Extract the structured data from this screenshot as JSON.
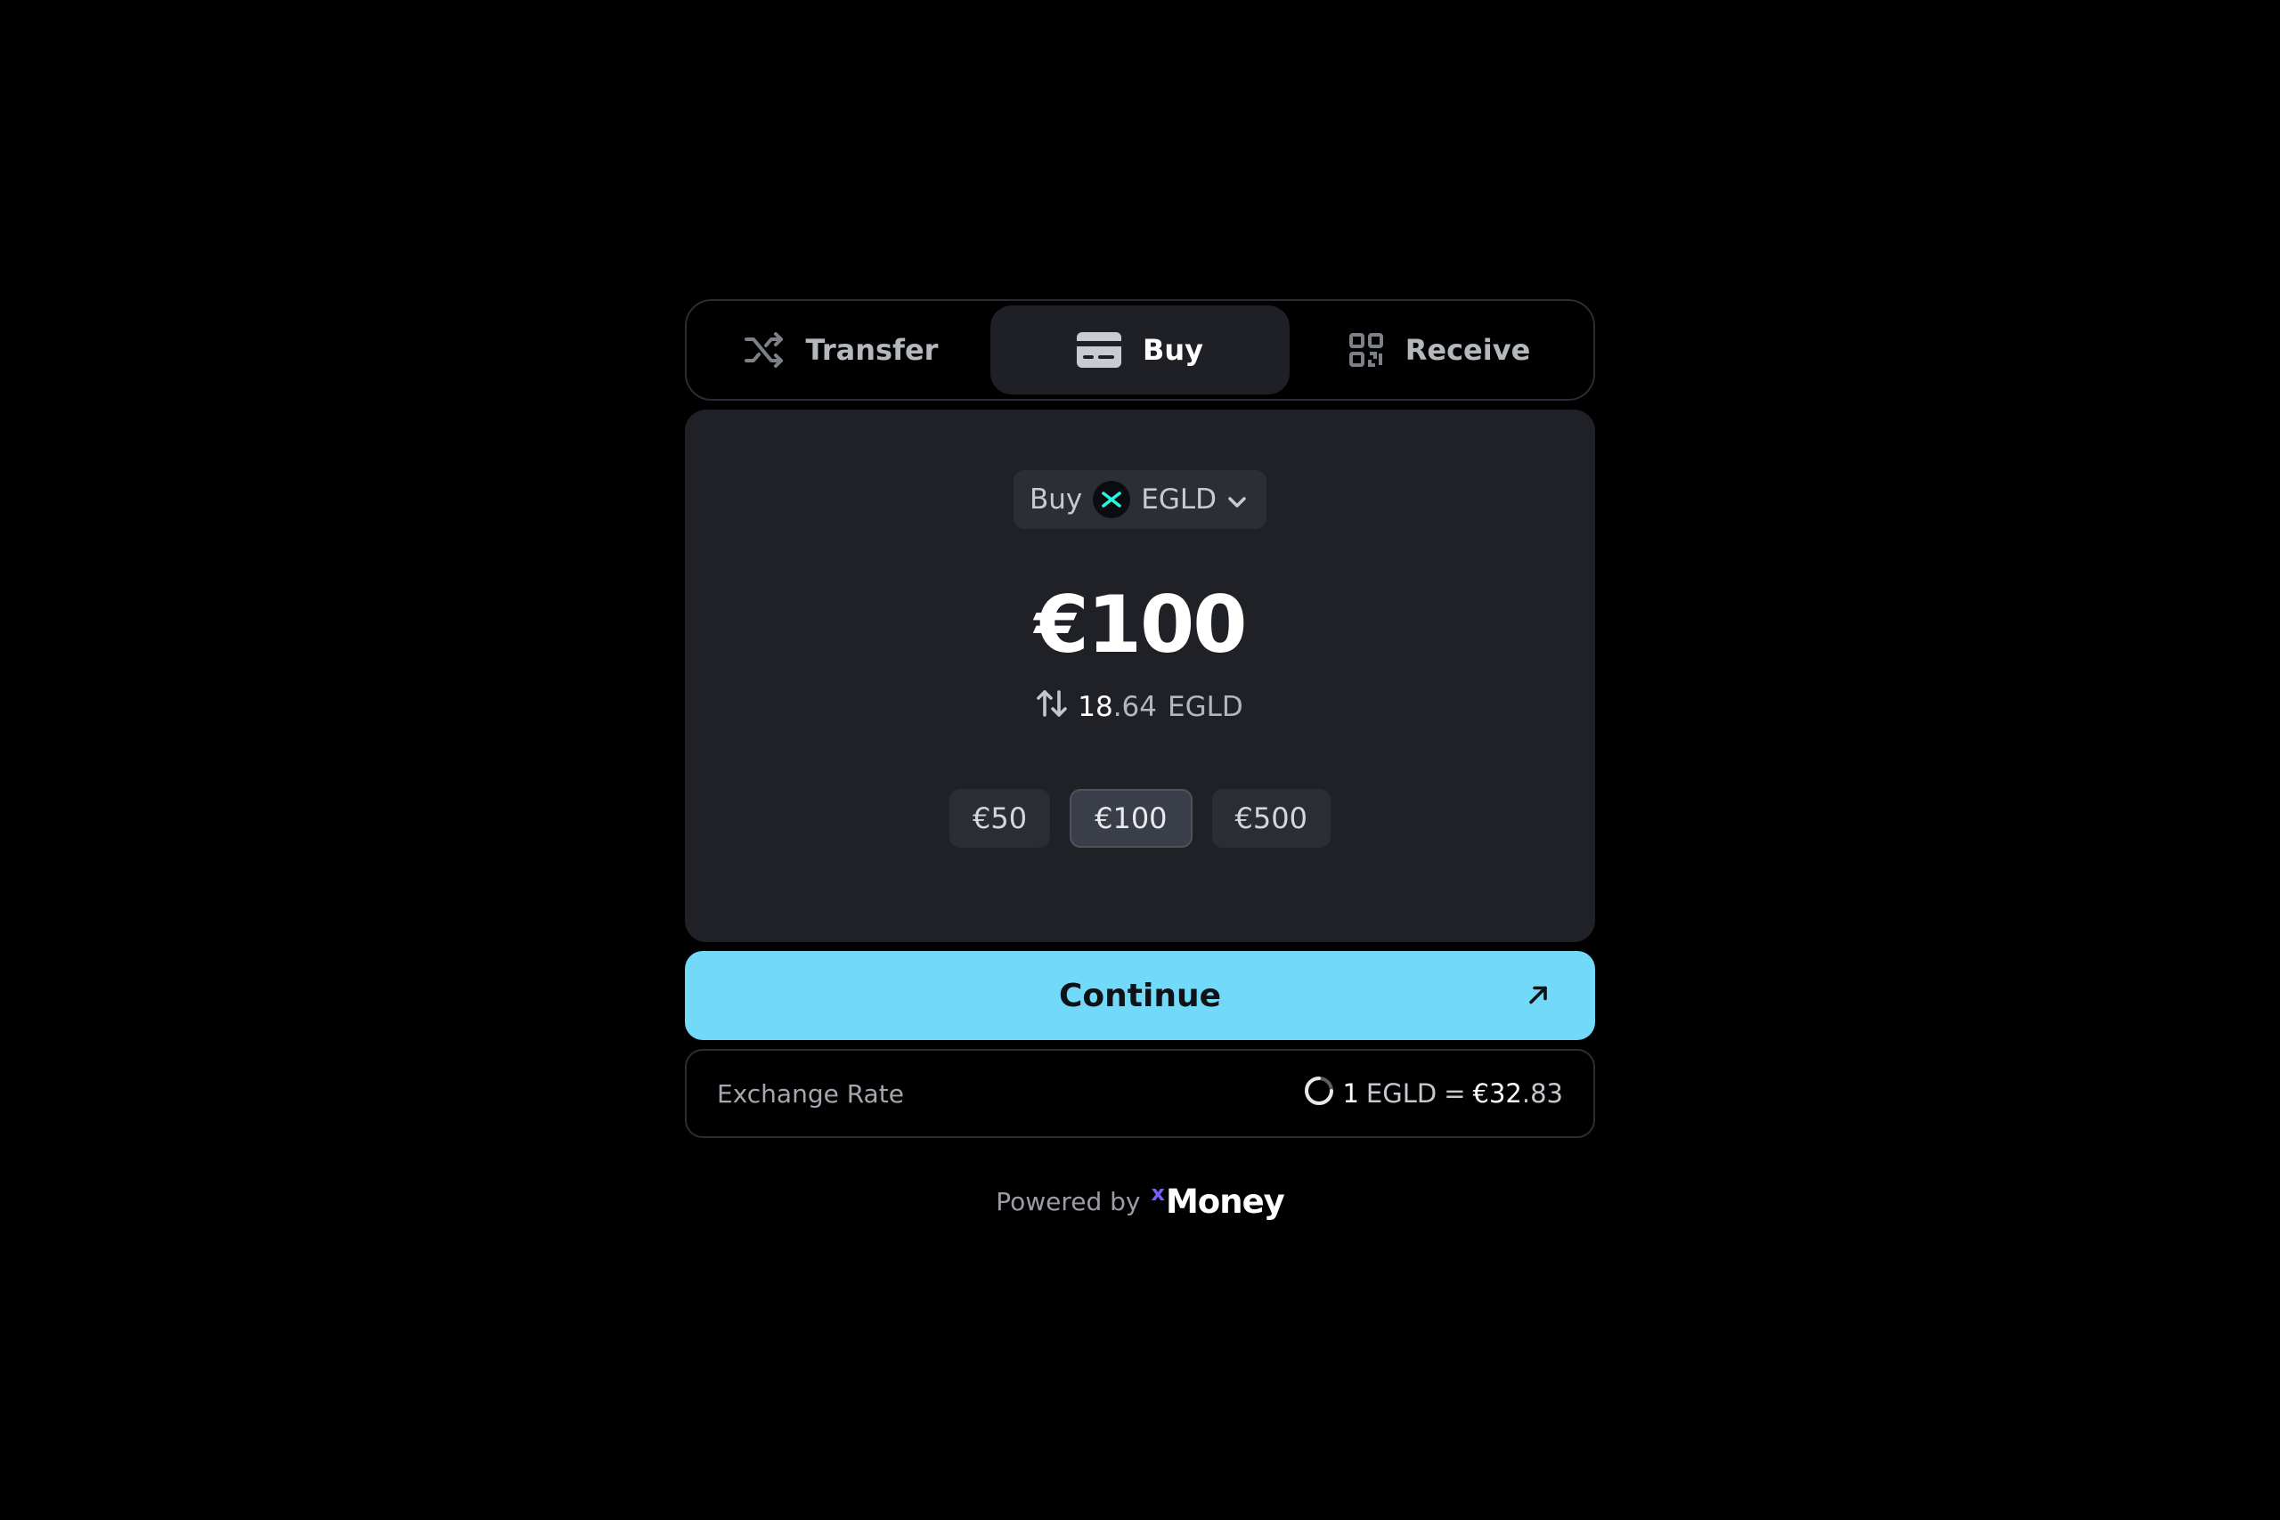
{
  "tabs": [
    {
      "label": "Transfer",
      "icon": "shuffle-icon",
      "active": false
    },
    {
      "label": "Buy",
      "icon": "credit-card-icon",
      "active": true
    },
    {
      "label": "Receive",
      "icon": "qr-code-icon",
      "active": false
    }
  ],
  "buy": {
    "action_label": "Buy",
    "token": "EGLD",
    "token_icon": "multiversx-logo-icon",
    "amount": "€100",
    "converted_int": "18",
    "converted_dec": ".64",
    "converted_unit": "EGLD",
    "presets": [
      "€50",
      "€100",
      "€500"
    ],
    "selected_preset": "€100"
  },
  "continue_label": "Continue",
  "rate": {
    "label": "Exchange Rate",
    "lhs": "1",
    "lhs_unit": "EGLD",
    "equals": "=",
    "rhs_int": "€32",
    "rhs_dec": ".83"
  },
  "footer": {
    "powered_by": "Powered by",
    "brand_mark": "x",
    "brand_name": "Money"
  },
  "colors": {
    "background": "#000000",
    "panel": "#1f2126",
    "accent": "#73d9f8",
    "brand_x": "#7b5cff",
    "token_x": "#23f7dd"
  }
}
